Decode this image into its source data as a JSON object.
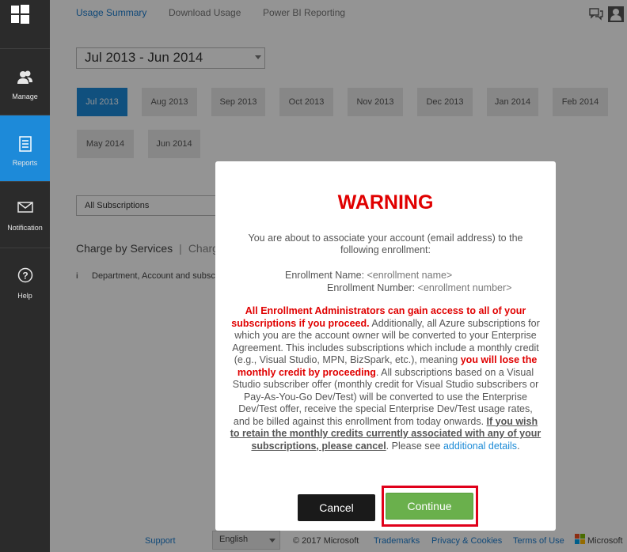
{
  "sidebar": {
    "items": [
      {
        "label": "Manage",
        "icon": "people-icon"
      },
      {
        "label": "Reports",
        "icon": "report-icon",
        "active": true
      },
      {
        "label": "Notification",
        "icon": "mail-icon"
      },
      {
        "label": "Help",
        "icon": "help-icon"
      }
    ]
  },
  "header": {
    "tabs": [
      {
        "label": "Usage Summary",
        "active": true
      },
      {
        "label": "Download Usage"
      },
      {
        "label": "Power BI Reporting"
      }
    ]
  },
  "date_range": {
    "value": "Jul 2013 - Jun 2014"
  },
  "months": [
    "Jul 2013",
    "Aug 2013",
    "Sep 2013",
    "Oct 2013",
    "Nov 2013",
    "Dec 2013",
    "Jan 2014",
    "Feb 2014",
    "May 2014",
    "Jun 2014"
  ],
  "subscriptions": {
    "value": "All Subscriptions"
  },
  "charge": {
    "by_services": "Charge by Services",
    "other": "Charg"
  },
  "info": {
    "text": "Department, Account and subsc"
  },
  "footer": {
    "support": "Support",
    "language": "English",
    "copyright": "© 2017 Microsoft",
    "trademarks": "Trademarks",
    "privacy": "Privacy & Cookies",
    "terms": "Terms of Use",
    "brand": "Microsoft"
  },
  "modal": {
    "title": "WARNING",
    "intro": "You are about to associate your account (email address) to the following enrollment:",
    "enrollment_name_label": "Enrollment Name:",
    "enrollment_name_value": "<enrollment name>",
    "enrollment_number_label": "Enrollment Number:",
    "enrollment_number_value": "<enrollment number>",
    "warning_bold": "All Enrollment Administrators can gain access to all of your subscriptions if you proceed.",
    "body_1": " Additionally, all Azure subscriptions for which you are the account owner will be converted to your Enterprise Agreement. This includes subscriptions which include a monthly credit (e.g., Visual Studio, MPN, BizSpark, etc.), meaning ",
    "lose_credit": "you will lose the monthly credit by proceeding",
    "body_2": ". All subscriptions based on a Visual Studio subscriber offer (monthly credit for Visual Studio subscribers or Pay-As-You-Go Dev/Test) will be converted to use the Enterprise Dev/Test offer, receive the special Enterprise Dev/Test usage rates, and be billed against this enrollment from today onwards. ",
    "retain": "If you wish to retain the monthly credits currently associated with any of your subscriptions, please cancel",
    "body_3": ". Please see ",
    "details_link": "additional details",
    "body_4": ".",
    "cancel_label": "Cancel",
    "continue_label": "Continue"
  },
  "colors": {
    "accent": "#1d8ad9",
    "warning": "#e00000",
    "continue": "#6ab04c",
    "highlight_frame": "#e0001a"
  }
}
